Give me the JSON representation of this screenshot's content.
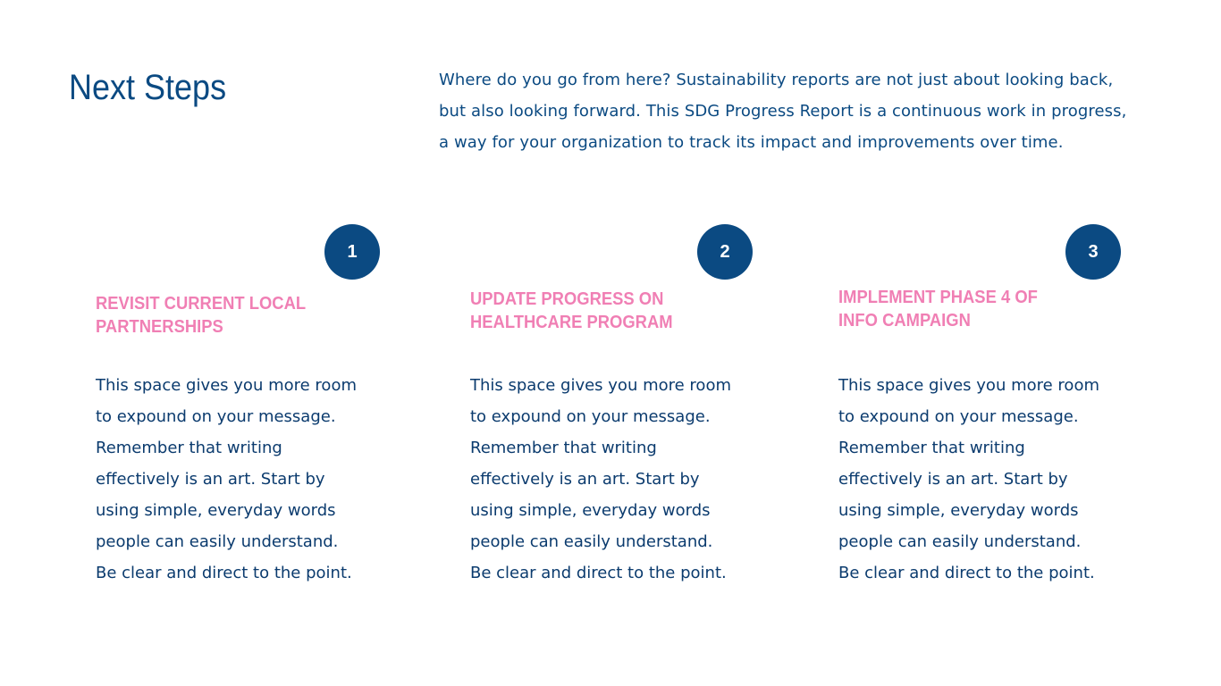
{
  "page": {
    "title": "Next Steps",
    "intro_lines": [
      "Where do you go from here? Sustainability reports are not just about looking back,",
      "but also looking forward. This SDG Progress Report is a continuous work in progress,",
      "a way for your organization to track its impact and improvements over time."
    ]
  },
  "steps": [
    {
      "number": "1",
      "heading_lines": [
        "REVISIT CURRENT LOCAL",
        "PARTNERSHIPS"
      ],
      "body_lines": [
        "This space gives you more room",
        "to expound on your message.",
        "Remember that writing",
        "effectively is an art. Start by",
        "using simple, everyday words",
        "people can easily understand.",
        "Be clear and direct to the point."
      ]
    },
    {
      "number": "2",
      "heading_lines": [
        "UPDATE PROGRESS ON",
        "HEALTHCARE PROGRAM"
      ],
      "body_lines": [
        "This space gives you more room",
        "to expound on your message.",
        "Remember that writing",
        "effectively is an art. Start by",
        "using simple, everyday words",
        "people can easily understand.",
        "Be clear and direct to the point."
      ]
    },
    {
      "number": "3",
      "heading_lines": [
        "IMPLEMENT PHASE 4 OF",
        "INFO CAMPAIGN"
      ],
      "body_lines": [
        "This space gives you more room",
        "to expound on your message.",
        "Remember that writing",
        "effectively is an art. Start by",
        "using simple, everyday words",
        "people can easily understand.",
        "Be clear and direct to the point."
      ]
    }
  ],
  "colors": {
    "primary": "#0b4a82",
    "accent": "#f07fb4",
    "background": "#ffffff"
  }
}
